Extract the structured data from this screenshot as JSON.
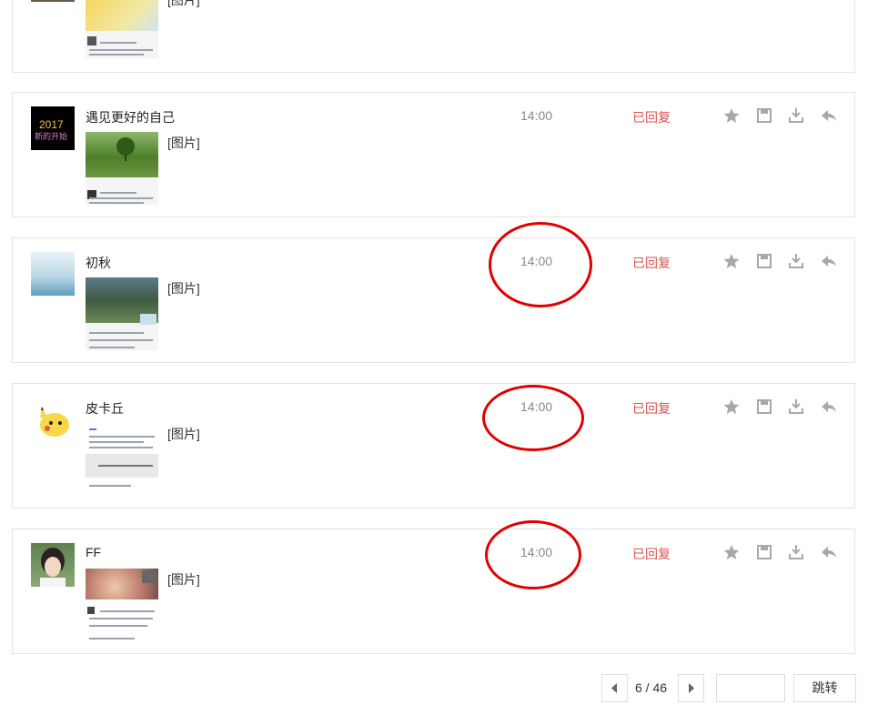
{
  "partial_top": {
    "type_label": "[图片]"
  },
  "messages": [
    {
      "name": "遇见更好的自己",
      "time": "14:00",
      "status": "已回复",
      "type_label": "[图片]",
      "avatar_text": "2017\n新的开始"
    },
    {
      "name": "初秋",
      "time": "14:00",
      "status": "已回复",
      "type_label": "[图片]"
    },
    {
      "name": "皮卡丘",
      "time": "14:00",
      "status": "已回复",
      "type_label": "[图片]"
    },
    {
      "name": "FF",
      "time": "14:00",
      "status": "已回复",
      "type_label": "[图片]"
    }
  ],
  "actions": [
    "star-icon",
    "save-icon",
    "download-icon",
    "reply-icon"
  ],
  "pagination": {
    "current_total": "6 / 46",
    "jump_label": "跳转",
    "jump_value": ""
  },
  "colors": {
    "status_red": "#d9534f",
    "annotation_red": "#e10000",
    "icon_gray": "#a8a8a8",
    "border": "#e3e3e3"
  }
}
